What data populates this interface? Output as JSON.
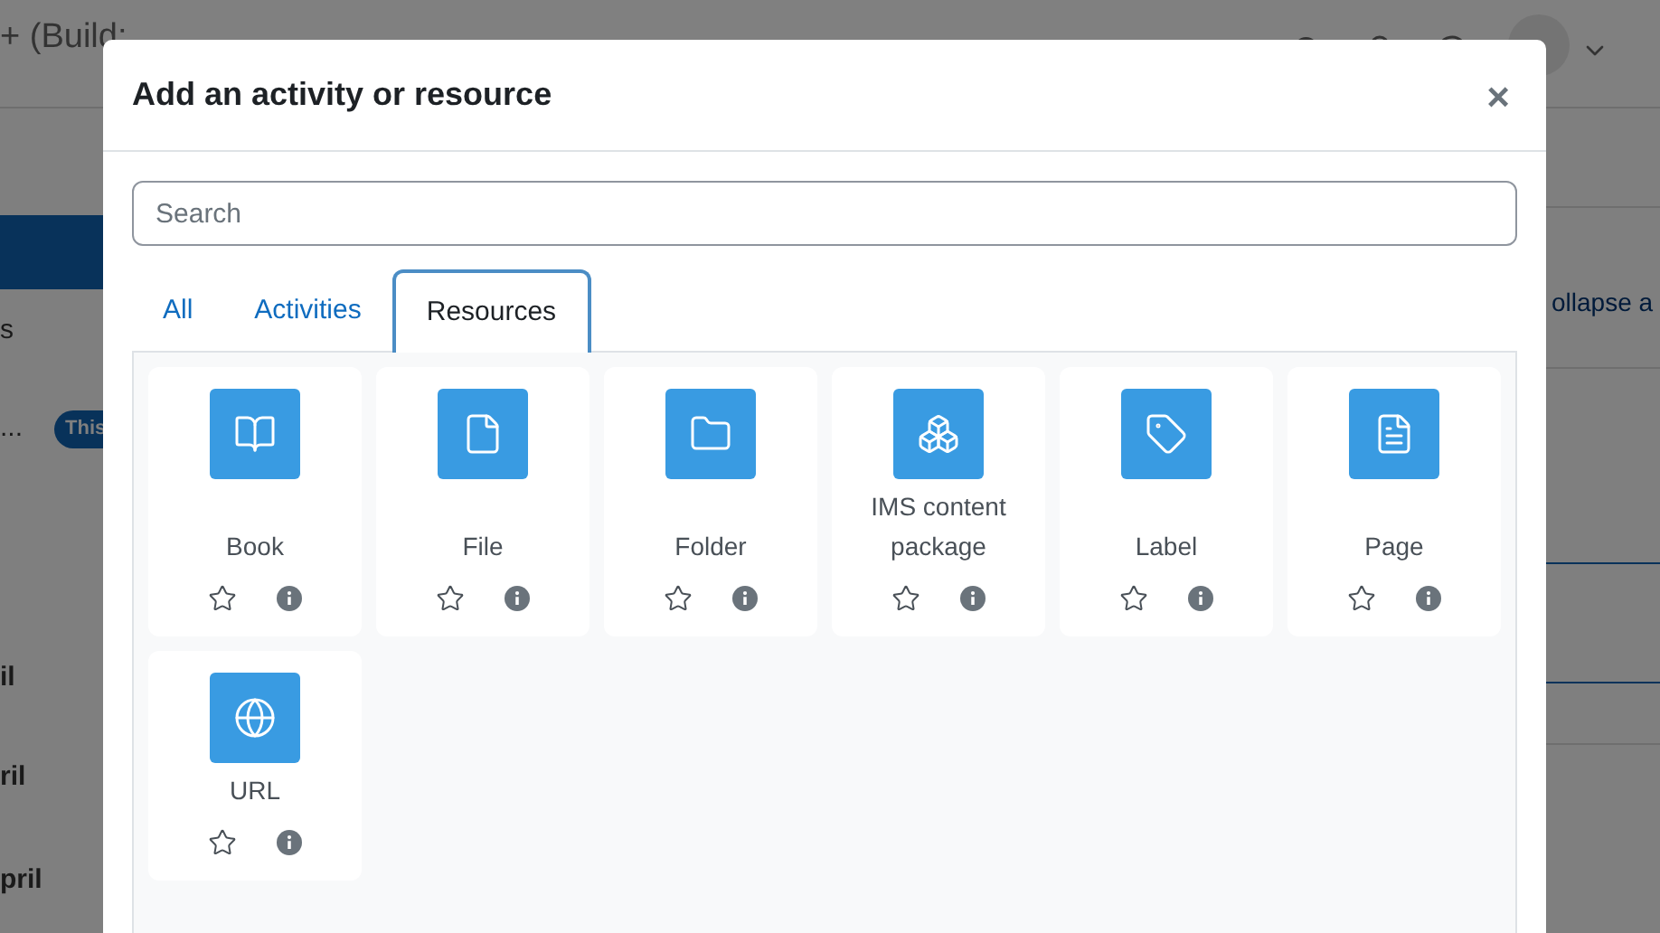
{
  "page": {
    "brand": "+ (Build:",
    "sidebar": [
      {
        "label": "s",
        "bold": false
      },
      {
        "label": "...",
        "bold": false
      },
      {
        "label": "il",
        "bold": true
      },
      {
        "label": "ril",
        "bold": true
      },
      {
        "label": "pril",
        "bold": true
      }
    ],
    "badge": "This",
    "collapse_link": "ollapse a"
  },
  "modal": {
    "title": "Add an activity or resource",
    "close": "×",
    "search": {
      "placeholder": "Search"
    },
    "tabs": [
      {
        "label": "All",
        "selected": false
      },
      {
        "label": "Activities",
        "selected": false
      },
      {
        "label": "Resources",
        "selected": true
      }
    ],
    "items": [
      {
        "name": "Book",
        "kind": "book",
        "starred": false
      },
      {
        "name": "File",
        "kind": "file",
        "starred": false
      },
      {
        "name": "Folder",
        "kind": "folder",
        "starred": false
      },
      {
        "name": "IMS content package",
        "kind": "package",
        "starred": false
      },
      {
        "name": "Label",
        "kind": "tag",
        "starred": false
      },
      {
        "name": "Page",
        "kind": "page",
        "starred": false
      },
      {
        "name": "URL",
        "kind": "globe",
        "starred": false
      }
    ]
  }
}
